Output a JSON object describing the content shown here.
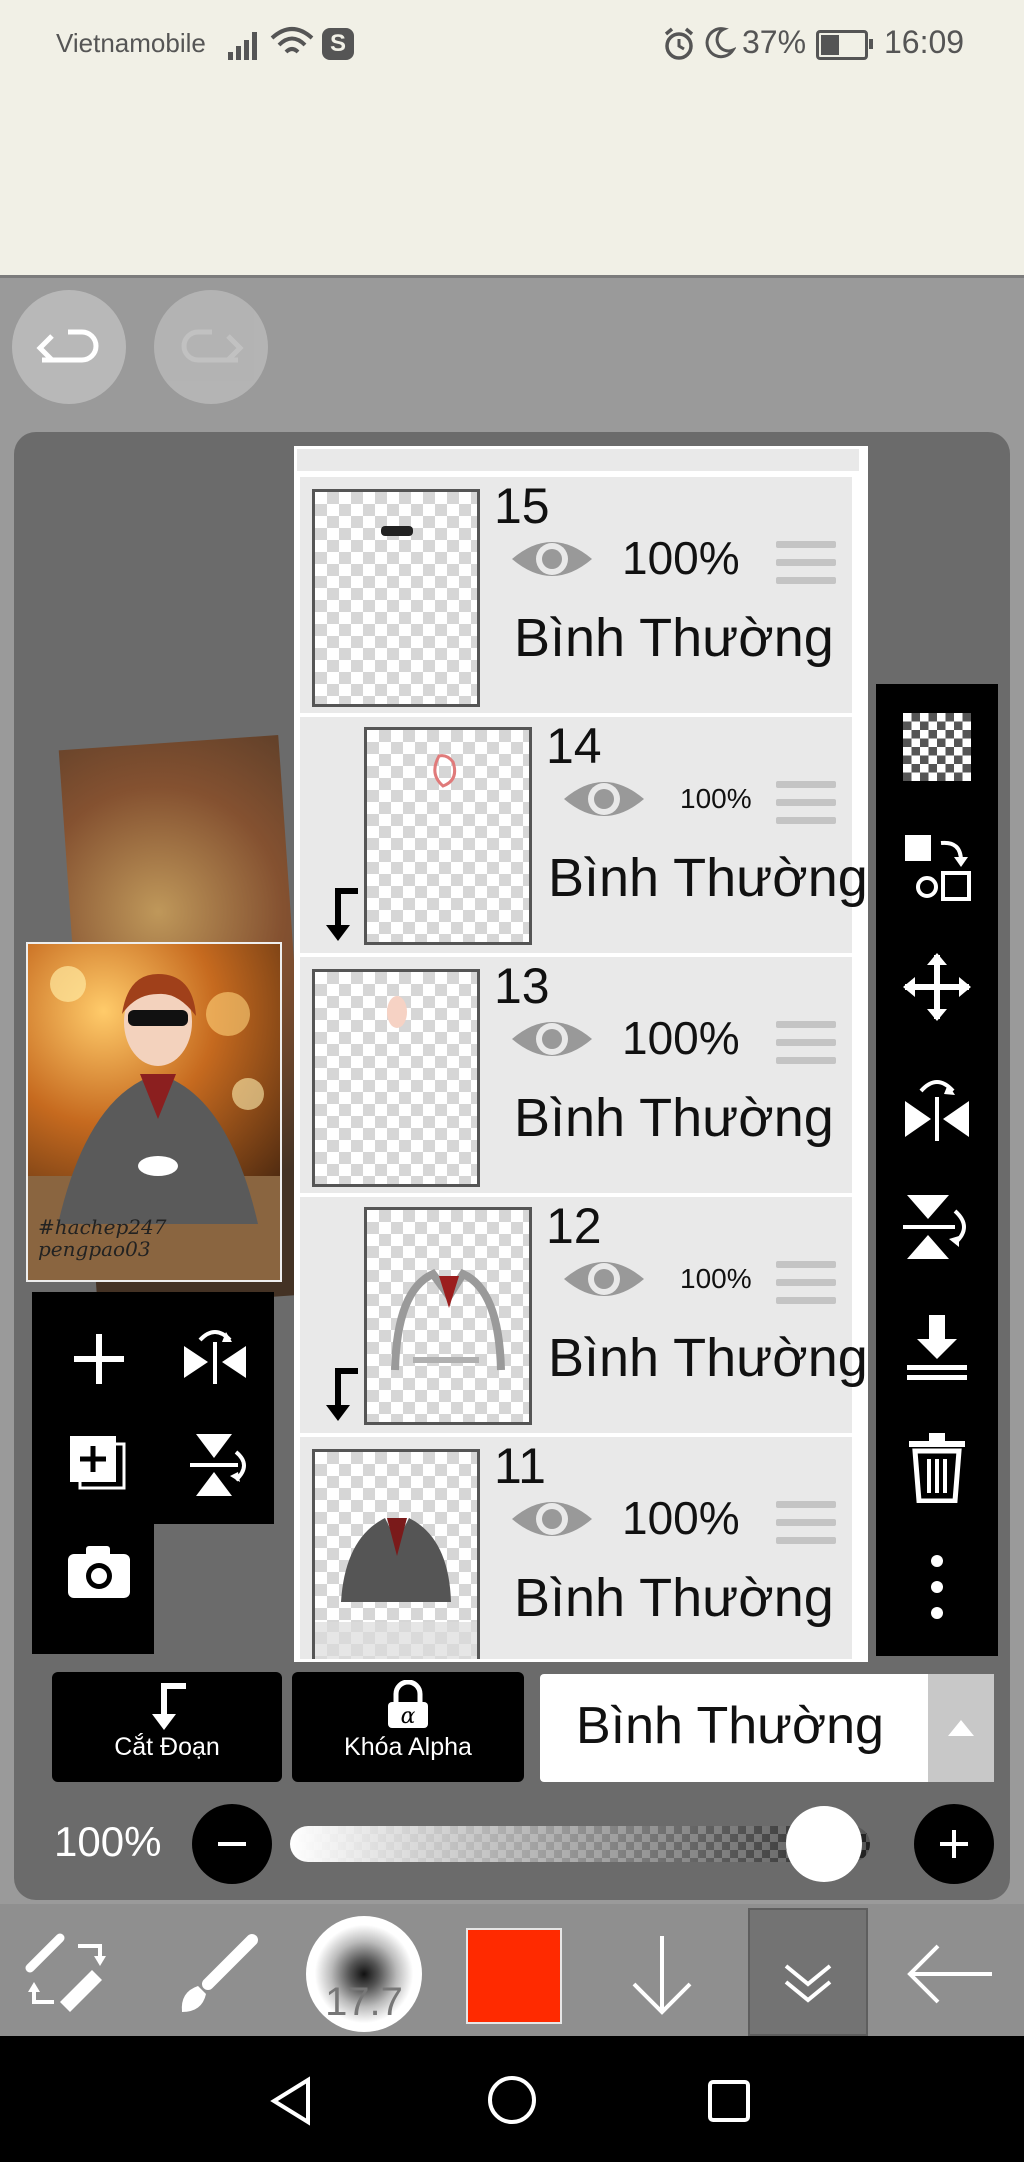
{
  "status_bar": {
    "carrier": "Vietnamobile",
    "battery": "37%",
    "time": "16:09"
  },
  "thumbnail_text": "#hachep247 pengpao03",
  "layers": [
    {
      "number": "15",
      "opacity": "100%",
      "mode": "Bình Thường",
      "clipped": false
    },
    {
      "number": "14",
      "opacity": "100%",
      "mode": "Bình Thường",
      "clipped": true
    },
    {
      "number": "13",
      "opacity": "100%",
      "mode": "Bình Thường",
      "clipped": false
    },
    {
      "number": "12",
      "opacity": "100%",
      "mode": "Bình Thường",
      "clipped": true
    },
    {
      "number": "11",
      "opacity": "100%",
      "mode": "Bình Thường",
      "clipped": false
    }
  ],
  "controls": {
    "clipping_label": "Cắt Đoạn",
    "alpha_lock_label": "Khóa Alpha",
    "blend_mode": "Bình Thường",
    "layer_opacity": "100%",
    "opacity_level": 0.92
  },
  "toolbar": {
    "brush_size": "17.7",
    "color": "#ff2a00"
  }
}
